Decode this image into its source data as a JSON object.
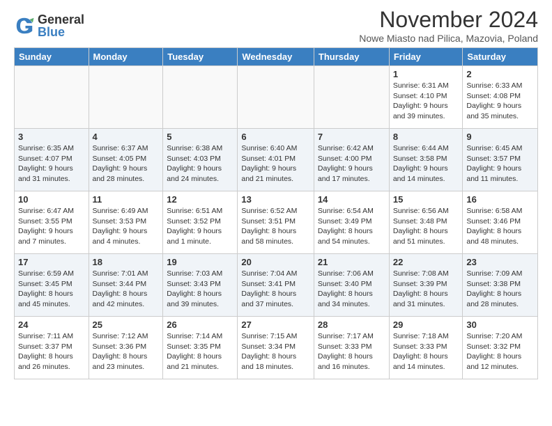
{
  "logo": {
    "general": "General",
    "blue": "Blue"
  },
  "title": "November 2024",
  "subtitle": "Nowe Miasto nad Pilica, Mazovia, Poland",
  "days": [
    "Sunday",
    "Monday",
    "Tuesday",
    "Wednesday",
    "Thursday",
    "Friday",
    "Saturday"
  ],
  "weeks": [
    [
      {
        "day": "",
        "info": ""
      },
      {
        "day": "",
        "info": ""
      },
      {
        "day": "",
        "info": ""
      },
      {
        "day": "",
        "info": ""
      },
      {
        "day": "",
        "info": ""
      },
      {
        "day": "1",
        "info": "Sunrise: 6:31 AM\nSunset: 4:10 PM\nDaylight: 9 hours and 39 minutes."
      },
      {
        "day": "2",
        "info": "Sunrise: 6:33 AM\nSunset: 4:08 PM\nDaylight: 9 hours and 35 minutes."
      }
    ],
    [
      {
        "day": "3",
        "info": "Sunrise: 6:35 AM\nSunset: 4:07 PM\nDaylight: 9 hours and 31 minutes."
      },
      {
        "day": "4",
        "info": "Sunrise: 6:37 AM\nSunset: 4:05 PM\nDaylight: 9 hours and 28 minutes."
      },
      {
        "day": "5",
        "info": "Sunrise: 6:38 AM\nSunset: 4:03 PM\nDaylight: 9 hours and 24 minutes."
      },
      {
        "day": "6",
        "info": "Sunrise: 6:40 AM\nSunset: 4:01 PM\nDaylight: 9 hours and 21 minutes."
      },
      {
        "day": "7",
        "info": "Sunrise: 6:42 AM\nSunset: 4:00 PM\nDaylight: 9 hours and 17 minutes."
      },
      {
        "day": "8",
        "info": "Sunrise: 6:44 AM\nSunset: 3:58 PM\nDaylight: 9 hours and 14 minutes."
      },
      {
        "day": "9",
        "info": "Sunrise: 6:45 AM\nSunset: 3:57 PM\nDaylight: 9 hours and 11 minutes."
      }
    ],
    [
      {
        "day": "10",
        "info": "Sunrise: 6:47 AM\nSunset: 3:55 PM\nDaylight: 9 hours and 7 minutes."
      },
      {
        "day": "11",
        "info": "Sunrise: 6:49 AM\nSunset: 3:53 PM\nDaylight: 9 hours and 4 minutes."
      },
      {
        "day": "12",
        "info": "Sunrise: 6:51 AM\nSunset: 3:52 PM\nDaylight: 9 hours and 1 minute."
      },
      {
        "day": "13",
        "info": "Sunrise: 6:52 AM\nSunset: 3:51 PM\nDaylight: 8 hours and 58 minutes."
      },
      {
        "day": "14",
        "info": "Sunrise: 6:54 AM\nSunset: 3:49 PM\nDaylight: 8 hours and 54 minutes."
      },
      {
        "day": "15",
        "info": "Sunrise: 6:56 AM\nSunset: 3:48 PM\nDaylight: 8 hours and 51 minutes."
      },
      {
        "day": "16",
        "info": "Sunrise: 6:58 AM\nSunset: 3:46 PM\nDaylight: 8 hours and 48 minutes."
      }
    ],
    [
      {
        "day": "17",
        "info": "Sunrise: 6:59 AM\nSunset: 3:45 PM\nDaylight: 8 hours and 45 minutes."
      },
      {
        "day": "18",
        "info": "Sunrise: 7:01 AM\nSunset: 3:44 PM\nDaylight: 8 hours and 42 minutes."
      },
      {
        "day": "19",
        "info": "Sunrise: 7:03 AM\nSunset: 3:43 PM\nDaylight: 8 hours and 39 minutes."
      },
      {
        "day": "20",
        "info": "Sunrise: 7:04 AM\nSunset: 3:41 PM\nDaylight: 8 hours and 37 minutes."
      },
      {
        "day": "21",
        "info": "Sunrise: 7:06 AM\nSunset: 3:40 PM\nDaylight: 8 hours and 34 minutes."
      },
      {
        "day": "22",
        "info": "Sunrise: 7:08 AM\nSunset: 3:39 PM\nDaylight: 8 hours and 31 minutes."
      },
      {
        "day": "23",
        "info": "Sunrise: 7:09 AM\nSunset: 3:38 PM\nDaylight: 8 hours and 28 minutes."
      }
    ],
    [
      {
        "day": "24",
        "info": "Sunrise: 7:11 AM\nSunset: 3:37 PM\nDaylight: 8 hours and 26 minutes."
      },
      {
        "day": "25",
        "info": "Sunrise: 7:12 AM\nSunset: 3:36 PM\nDaylight: 8 hours and 23 minutes."
      },
      {
        "day": "26",
        "info": "Sunrise: 7:14 AM\nSunset: 3:35 PM\nDaylight: 8 hours and 21 minutes."
      },
      {
        "day": "27",
        "info": "Sunrise: 7:15 AM\nSunset: 3:34 PM\nDaylight: 8 hours and 18 minutes."
      },
      {
        "day": "28",
        "info": "Sunrise: 7:17 AM\nSunset: 3:33 PM\nDaylight: 8 hours and 16 minutes."
      },
      {
        "day": "29",
        "info": "Sunrise: 7:18 AM\nSunset: 3:33 PM\nDaylight: 8 hours and 14 minutes."
      },
      {
        "day": "30",
        "info": "Sunrise: 7:20 AM\nSunset: 3:32 PM\nDaylight: 8 hours and 12 minutes."
      }
    ]
  ]
}
